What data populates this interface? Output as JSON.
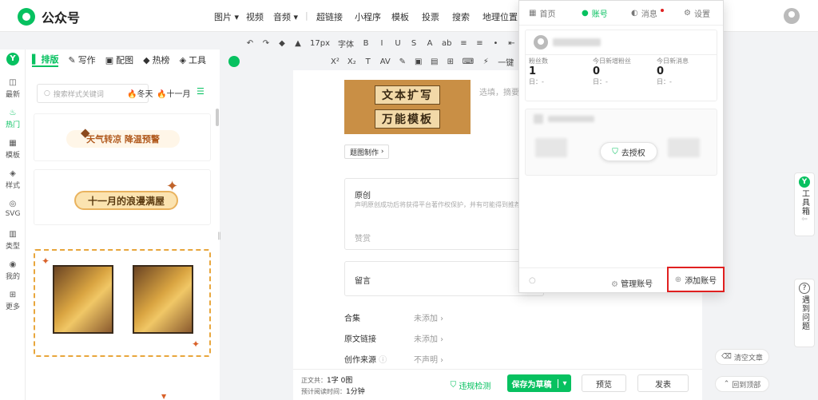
{
  "app": {
    "title": "公众号"
  },
  "nav": {
    "items": [
      "图片",
      "视频",
      "音频",
      "超链接",
      "小程序",
      "模板",
      "投票",
      "搜索",
      "地理位置"
    ]
  },
  "toolbar": {
    "row1": [
      "↶",
      "↷",
      "◆",
      "▲",
      "17px",
      "字体",
      "B",
      "I",
      "U",
      "S",
      "A",
      "ab",
      "≡",
      "≡",
      "•",
      "⇤",
      "⇥",
      "</>",
      "☺"
    ],
    "row2": [
      "X²",
      "X₂",
      "T",
      "AV",
      "✎",
      "▣",
      "▤",
      "⊞",
      "⌨",
      "⚡",
      "一键"
    ]
  },
  "rail": {
    "items": [
      {
        "label": "最新",
        "icon": "◫",
        "active": false
      },
      {
        "label": "热门",
        "icon": "♨",
        "active": true
      },
      {
        "label": "模板",
        "icon": "▦",
        "active": false
      },
      {
        "label": "样式",
        "icon": "◈",
        "active": false
      },
      {
        "label": "SVG",
        "icon": "◎",
        "active": false
      },
      {
        "label": "类型",
        "icon": "▥",
        "active": false
      },
      {
        "label": "我的",
        "icon": "◉",
        "active": false
      },
      {
        "label": "更多",
        "icon": "⊞",
        "active": false
      }
    ]
  },
  "panel": {
    "tabs": [
      {
        "label": "排版",
        "icon": "▌",
        "active": true
      },
      {
        "label": "写作",
        "icon": "✎",
        "active": false
      },
      {
        "label": "配图",
        "icon": "▣",
        "active": false
      },
      {
        "label": "热榜",
        "icon": "◆",
        "active": false
      },
      {
        "label": "工具",
        "icon": "◈",
        "active": false
      }
    ],
    "search_placeholder": "搜索样式关键词",
    "chips": [
      "冬天",
      "十一月"
    ],
    "templates": [
      "天气转凉 降温预警",
      "十一月的浪漫满屋"
    ]
  },
  "editor": {
    "cover_lines": [
      "文本扩写",
      "万能模板"
    ],
    "summary_placeholder": "选填，摘要",
    "make_button": "题图制作",
    "original": {
      "title": "原创",
      "desc": "声明原创成功后将获得平台著作权保护，并有可能得到推荐",
      "reward": "赞赏"
    },
    "comment": "留言",
    "meta": [
      {
        "label": "合集",
        "value": "未添加"
      },
      {
        "label": "原文链接",
        "value": "未添加"
      },
      {
        "label": "创作来源",
        "value": "不声明"
      }
    ]
  },
  "bottombar": {
    "count_label": "正文共：",
    "count_value": "1字 0图",
    "read_label": "预计阅读时间：",
    "read_value": "1分钟",
    "check_label": "违规检测",
    "save_label": "保存为草稿",
    "preview_label": "预览",
    "publish_label": "发表"
  },
  "popup": {
    "tabs": [
      {
        "label": "首页",
        "icon": "▦",
        "active": false
      },
      {
        "label": "账号",
        "icon": "●",
        "active": true
      },
      {
        "label": "消息",
        "icon": "◐",
        "active": false,
        "badge": true
      },
      {
        "label": "设置",
        "icon": "⚙",
        "active": false
      }
    ],
    "stats": [
      {
        "label": "粉丝数",
        "value": "1",
        "sub": "日：-"
      },
      {
        "label": "今日新增粉丝",
        "value": "0",
        "sub": "日：-"
      },
      {
        "label": "今日新消息",
        "value": "0",
        "sub": "日：-"
      }
    ],
    "authorize_label": "去授权",
    "manage_label": "管理账号",
    "add_label": "添加账号"
  },
  "floating": {
    "toolbox_label": "工具箱",
    "help_label": "遇到问题",
    "clear_label": "清空文章",
    "top_label": "回到顶部"
  },
  "colors": {
    "brand": "#07c160",
    "highlight": "#e02020"
  }
}
